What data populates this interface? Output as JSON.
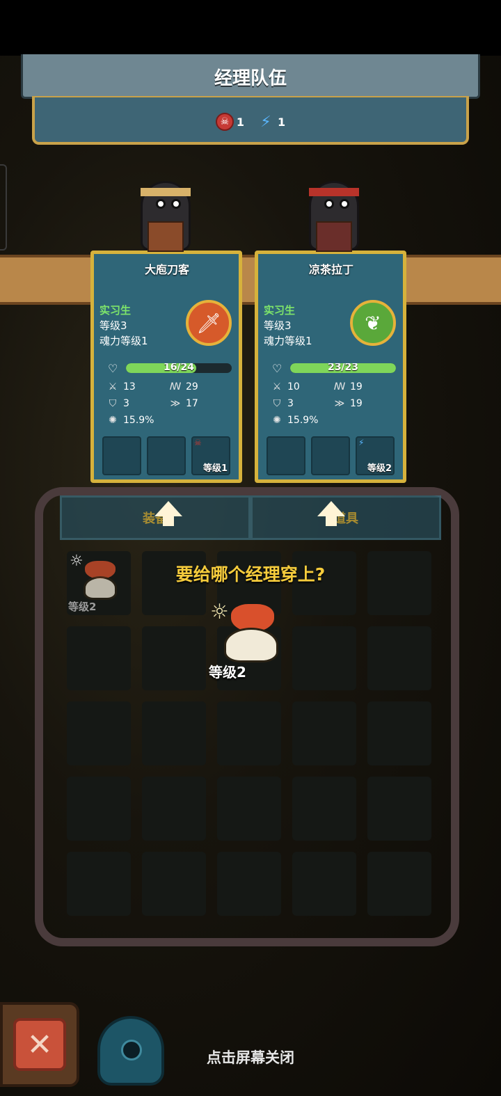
{
  "header": {
    "title": "经理队伍",
    "skull_count": "1",
    "bolt_count": "1"
  },
  "managers": [
    {
      "name": "大庖刀客",
      "rank": "实习生",
      "level": "等级3",
      "soul_level": "魂力等级1",
      "hp_text": "16/24",
      "hp_fraction": 0.667,
      "attack": "13",
      "stat_b": "29",
      "defense": "3",
      "speed": "17",
      "crit": "15.9%",
      "equipped_item_level": "等级1",
      "colors": {
        "medal": "#d65a2a",
        "band": "#d8b26a"
      }
    },
    {
      "name": "凉茶拉丁",
      "rank": "实习生",
      "level": "等级3",
      "soul_level": "魂力等级1",
      "hp_text": "23/23",
      "hp_fraction": 1.0,
      "attack": "10",
      "stat_b": "19",
      "defense": "3",
      "speed": "19",
      "crit": "15.9%",
      "equipped_item_level": "等级2",
      "colors": {
        "medal": "#5aa83a",
        "band": "#b8332a"
      }
    }
  ],
  "tabs": [
    "装备",
    "道具"
  ],
  "inventory": {
    "first_item_level": "等级2"
  },
  "prompt": "要给哪个经理穿上?",
  "selected_item_level": "等级2",
  "footer": {
    "tap_to_close": "点击屏幕关闭",
    "close_glyph": "✕"
  },
  "icons": {
    "skull": "skull-icon",
    "bolt": "bolt-icon",
    "heart": "heart-icon",
    "sword": "sword-icon",
    "shield": "shield-icon",
    "boot": "boot-icon",
    "speed": "speed-icon",
    "crit": "crit-icon",
    "sun": "sun-icon"
  },
  "colors": {
    "accent_gold": "#d6b23c",
    "card_teal": "#2f6678",
    "rank_green": "#7ee56a",
    "prompt_yellow": "#f6cc3c"
  }
}
